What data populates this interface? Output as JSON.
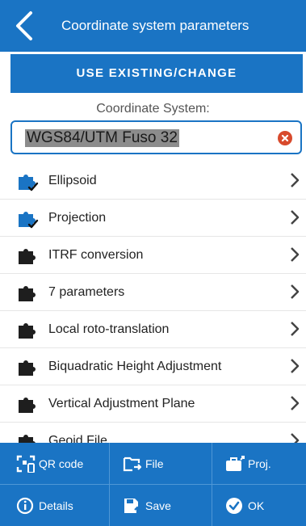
{
  "header": {
    "title": "Coordinate system parameters",
    "back_icon": "chevron-left-icon"
  },
  "use_existing_button": {
    "label": "USE EXISTING/CHANGE"
  },
  "coordinate_system": {
    "label": "Coordinate System:",
    "value": "WGS84/UTM Fuso 32",
    "clear_icon": "clear-icon"
  },
  "list": {
    "items": [
      {
        "label": "Ellipsoid",
        "icon": "puzzle-check-icon",
        "active": true
      },
      {
        "label": "Projection",
        "icon": "puzzle-check-icon",
        "active": true
      },
      {
        "label": "ITRF conversion",
        "icon": "puzzle-icon",
        "active": false
      },
      {
        "label": "7 parameters",
        "icon": "puzzle-icon",
        "active": false
      },
      {
        "label": "Local roto-translation",
        "icon": "puzzle-icon",
        "active": false
      },
      {
        "label": "Biquadratic Height Adjustment",
        "icon": "puzzle-icon",
        "active": false
      },
      {
        "label": "Vertical Adjustment Plane",
        "icon": "puzzle-icon",
        "active": false
      },
      {
        "label": "Geoid File",
        "icon": "puzzle-icon",
        "active": false
      }
    ]
  },
  "toolbar": {
    "qr_code": "QR code",
    "file": "File",
    "proj": "Proj.",
    "details": "Details",
    "save": "Save",
    "ok": "OK"
  },
  "colors": {
    "primary": "#1a74c4",
    "active_icon": "#1a74c4",
    "inactive_icon": "#1e1e1e",
    "clear_icon": "#d84a2c"
  }
}
